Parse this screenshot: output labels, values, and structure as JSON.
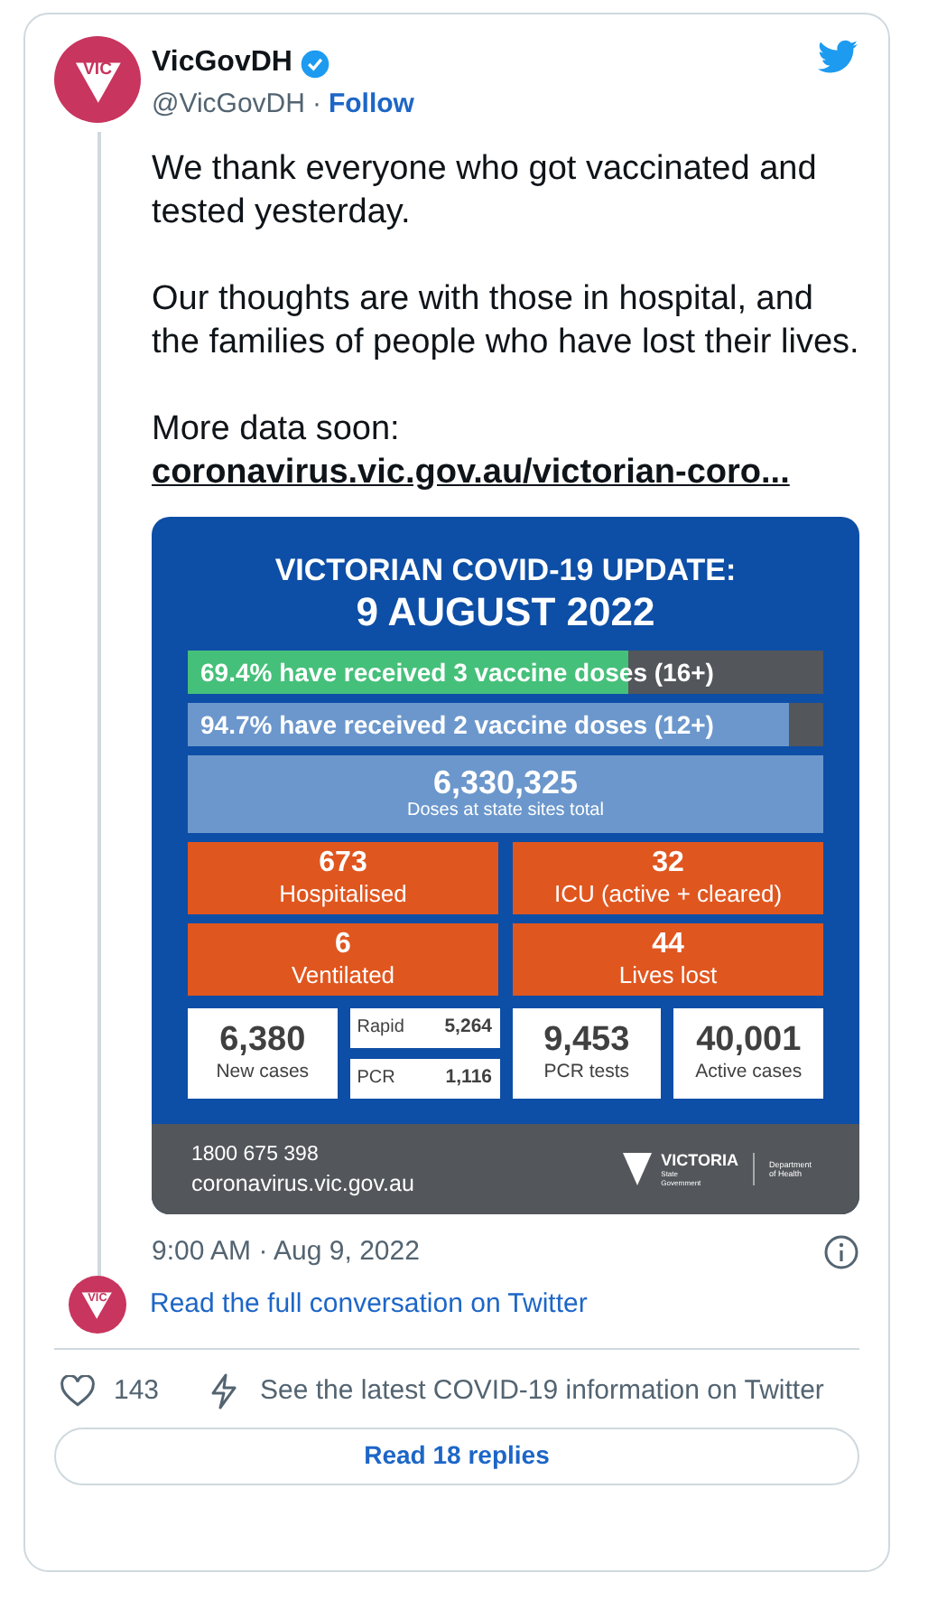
{
  "author": {
    "avatar_text": "VIC",
    "name": "VicGovDH",
    "verified": true,
    "handle": "@VicGovDH",
    "separator": "·",
    "follow": "Follow"
  },
  "tweet_paragraphs": [
    "We thank everyone who got vaccinated and tested yesterday.",
    "Our thoughts are with those in hospital, and the families of people who have lost their lives.",
    "More data soon:"
  ],
  "link": "coronavirus.vic.gov.au/victorian-coro...",
  "infographic": {
    "title": "VICTORIAN COVID-19 UPDATE:",
    "date": "9 AUGUST 2022",
    "bars": [
      {
        "text": "69.4% have received 3 vaccine doses (16+)",
        "level": 0.694,
        "color": "#45c07a"
      },
      {
        "text": "94.7% have received 2 vaccine doses (12+)",
        "level": 0.947,
        "color": "#6b97cc"
      }
    ],
    "doses": {
      "value": "6,330,325",
      "label": "Doses at state sites total"
    },
    "alerts": [
      {
        "value": "673",
        "label": "Hospitalised"
      },
      {
        "value": "32",
        "label": "ICU (active + cleared)"
      },
      {
        "value": "6",
        "label": "Ventilated"
      },
      {
        "value": "44",
        "label": "Lives lost"
      }
    ],
    "stats": [
      {
        "kind": "stat",
        "value": "6,380",
        "label": "New cases"
      },
      {
        "kind": "split",
        "rows": [
          {
            "label": "Rapid",
            "value": "5,264"
          },
          {
            "label": "PCR",
            "value": "1,116"
          }
        ]
      },
      {
        "kind": "stat",
        "value": "9,453",
        "label": "PCR tests"
      },
      {
        "kind": "stat",
        "value": "40,001",
        "label": "Active cases"
      }
    ],
    "footer": {
      "phone": "1800 675 398",
      "site": "coronavirus.vic.gov.au",
      "logo": "VICTORIA",
      "logo_sub": "State Government",
      "department": "Department of Health"
    }
  },
  "timestamp": "9:00 AM · Aug 9, 2022",
  "conversation_avatar_text": "VIC",
  "conversation_link": "Read the full conversation on Twitter",
  "likes": "143",
  "covid_info": "See the latest COVID-19 information on Twitter",
  "replies_button": "Read 18 replies"
}
